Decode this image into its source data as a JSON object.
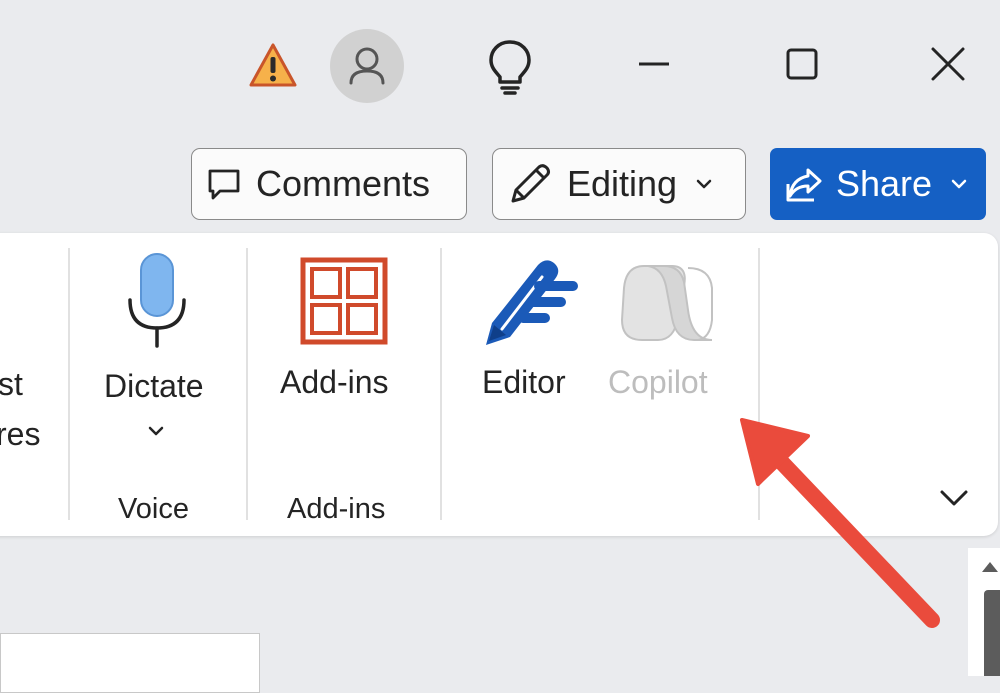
{
  "buttons": {
    "comments": "Comments",
    "editing": "Editing",
    "share": "Share"
  },
  "ribbon": {
    "cut_label_line1": "st",
    "cut_label_line2": "res",
    "dictate": "Dictate",
    "voice_group": "Voice",
    "addins": "Add-ins",
    "addins_group": "Add-ins",
    "editor": "Editor",
    "copilot": "Copilot"
  },
  "colors": {
    "share_bg": "#1560c4",
    "addins_icon": "#d04a2b",
    "editor_icon": "#1b5ab8",
    "mic_fill": "#7fb6ef",
    "copilot_disabled": "#bdbdbd",
    "annotation_arrow": "#ea4b3c"
  },
  "icons": [
    "warning-icon",
    "account-icon",
    "lightbulb-icon",
    "minimize-icon",
    "maximize-icon",
    "close-icon",
    "comment-icon",
    "pencil-icon",
    "share-icon",
    "microphone-icon",
    "addins-icon",
    "editor-icon",
    "copilot-icon",
    "chevron-down-icon"
  ]
}
